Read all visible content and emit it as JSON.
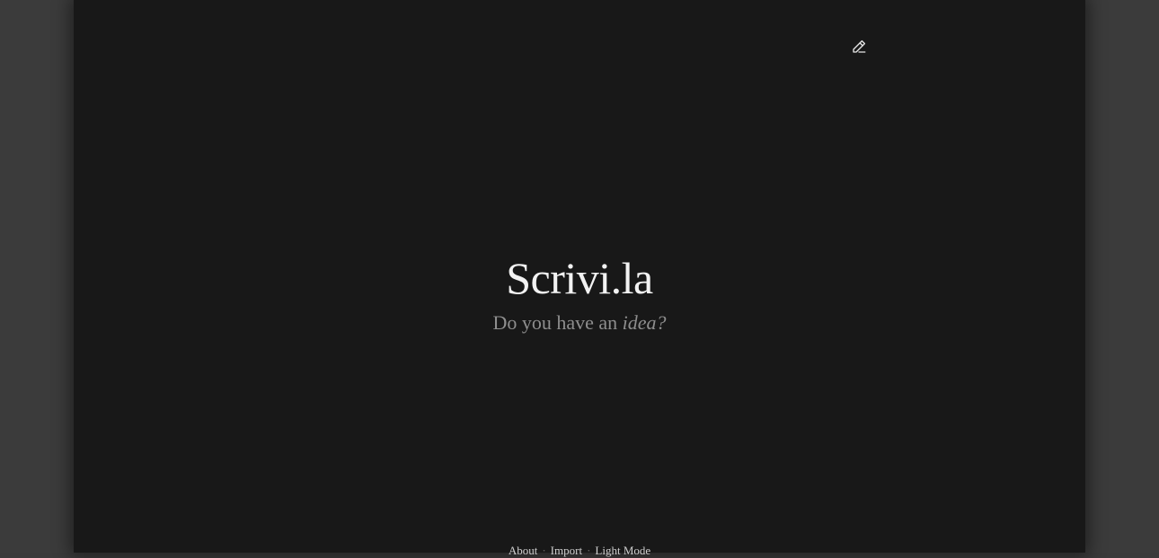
{
  "app": {
    "title": "Scrivi.la",
    "tagline_prefix": "Do you have an ",
    "tagline_emphasis": "idea?"
  },
  "toolbar": {
    "edit_icon": "pencil-edit-icon"
  },
  "footer": {
    "links": [
      "About",
      "Import",
      "Light Mode"
    ],
    "separator": "·"
  },
  "colors": {
    "page_background": "#181818",
    "outer_background": "#3b3b3b",
    "title": "#f2f2f2",
    "tagline": "#8e8e8e"
  }
}
